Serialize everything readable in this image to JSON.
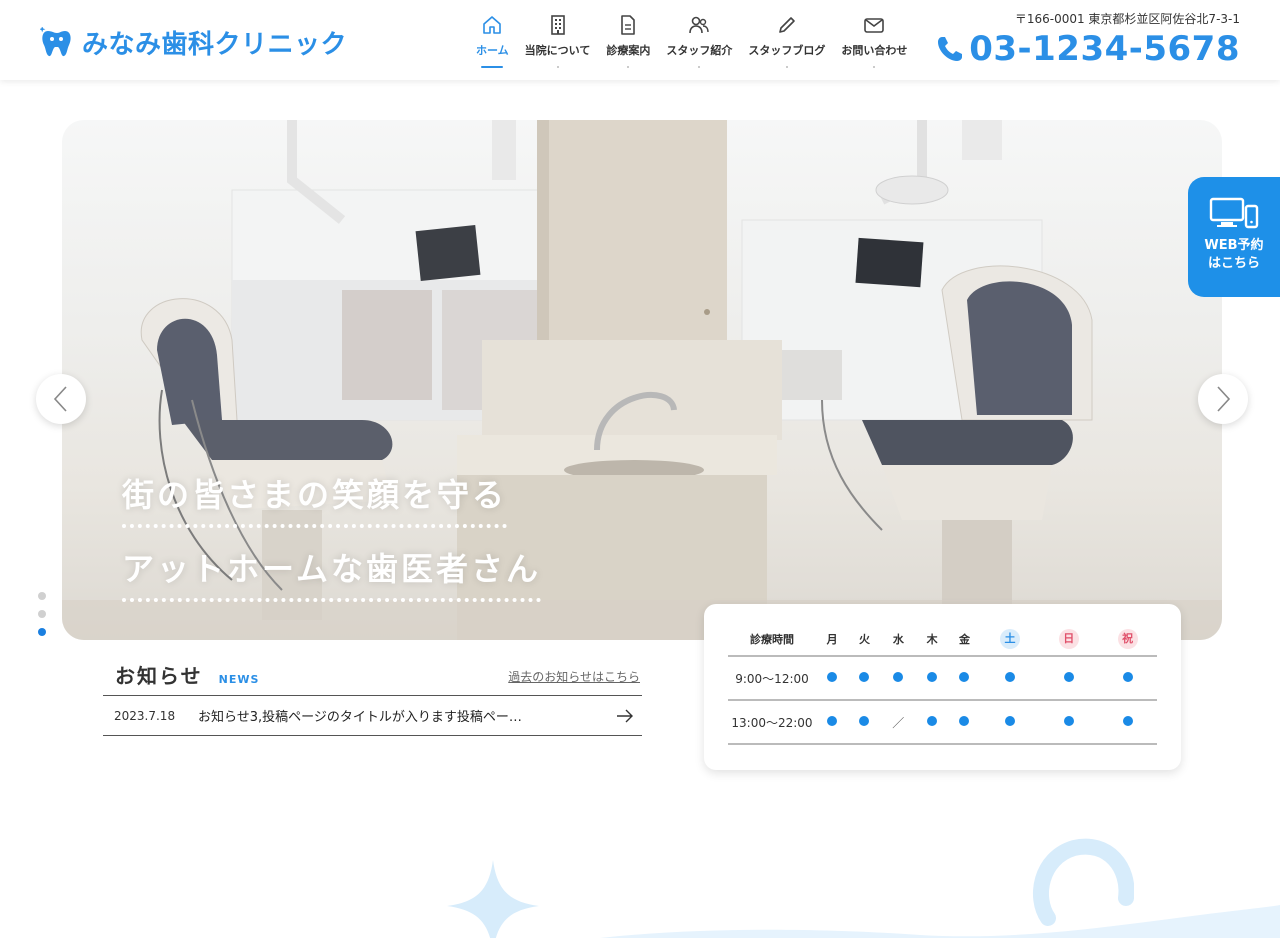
{
  "header": {
    "logo_text": "みなみ歯科クリニック",
    "address": "〒166-0001 東京都杉並区阿佐谷北7-3-1",
    "phone": "03-1234-5678"
  },
  "nav": {
    "items": [
      {
        "label": "ホーム",
        "icon": "home-icon",
        "active": true
      },
      {
        "label": "当院について",
        "icon": "building-icon",
        "active": false
      },
      {
        "label": "診療案内",
        "icon": "document-icon",
        "active": false
      },
      {
        "label": "スタッフ紹介",
        "icon": "staff-icon",
        "active": false
      },
      {
        "label": "スタッフブログ",
        "icon": "pencil-icon",
        "active": false
      },
      {
        "label": "お問い合わせ",
        "icon": "mail-icon",
        "active": false
      }
    ]
  },
  "hero": {
    "line1": "街の皆さまの笑顔を守る",
    "line2": "アットホームな歯医者さん",
    "slide_count": 3,
    "active_slide": 3
  },
  "web_reserve": {
    "label": "WEB予約\nはこちら",
    "icon": "devices-icon"
  },
  "news": {
    "title": "お知らせ",
    "subtitle": "NEWS",
    "more_link": "過去のお知らせはこちら",
    "items": [
      {
        "date": "2023.7.18",
        "text": "お知らせ3,投稿ページのタイトルが入ります投稿ペー…"
      }
    ]
  },
  "hours": {
    "header_label": "診療時間",
    "days": [
      "月",
      "火",
      "水",
      "木",
      "金",
      "土",
      "日",
      "祝"
    ],
    "rows": [
      {
        "time": "9:00〜12:00",
        "status": [
          "open",
          "open",
          "open",
          "open",
          "open",
          "open",
          "open",
          "open"
        ]
      },
      {
        "time": "13:00〜22:00",
        "status": [
          "open",
          "open",
          "closed",
          "open",
          "open",
          "open",
          "open",
          "open"
        ]
      }
    ],
    "closed_symbol": "／"
  },
  "colors": {
    "brand": "#2b8fe6",
    "reserve_bg": "#1e90e8",
    "open_dot": "#1a8ae6",
    "saturday": "#2b8fe6",
    "sunday": "#e0506a"
  }
}
